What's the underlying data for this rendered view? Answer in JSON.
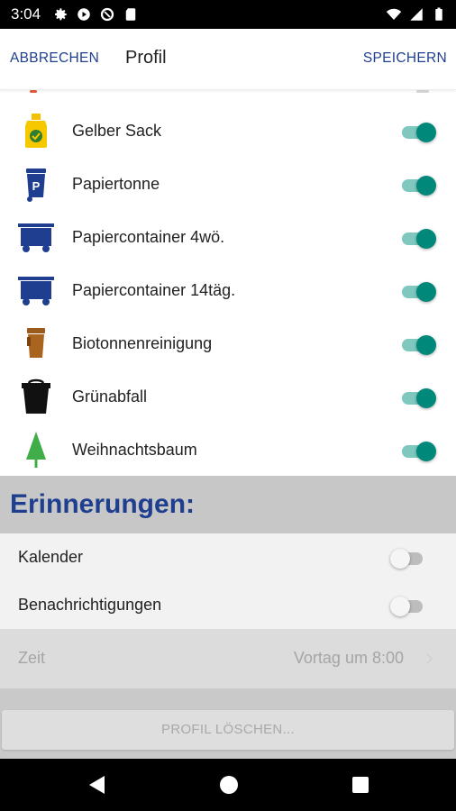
{
  "status": {
    "time": "3:04"
  },
  "toolbar": {
    "cancel": "ABBRECHEN",
    "title": "Profil",
    "save": "SPEICHERN"
  },
  "bins": [
    {
      "label": "Gelber Sack",
      "icon": "yellow-sack-icon",
      "enabled": true
    },
    {
      "label": "Papiertonne",
      "icon": "paper-bin-icon",
      "enabled": true
    },
    {
      "label": "Papiercontainer 4wö.",
      "icon": "paper-container-icon",
      "enabled": true
    },
    {
      "label": "Papiercontainer 14täg.",
      "icon": "paper-container-icon",
      "enabled": true
    },
    {
      "label": "Biotonnenreinigung",
      "icon": "bio-bin-icon",
      "enabled": true
    },
    {
      "label": "Grünabfall",
      "icon": "green-waste-bin-icon",
      "enabled": true
    },
    {
      "label": "Weihnachtsbaum",
      "icon": "christmas-tree-icon",
      "enabled": true
    }
  ],
  "reminders": {
    "title": "Erinnerungen:",
    "calendar": {
      "label": "Kalender",
      "enabled": false
    },
    "notifications": {
      "label": "Benachrichtigungen",
      "enabled": false
    },
    "time": {
      "label": "Zeit",
      "value": "Vortag um 8:00"
    }
  },
  "delete_profile": "PROFIL LÖSCHEN...",
  "colors": {
    "accent": "#1f3e8f",
    "toggle_on": "#00897b",
    "toggle_on_track": "#7ec8bf",
    "section_bg": "#c7c7c7"
  }
}
